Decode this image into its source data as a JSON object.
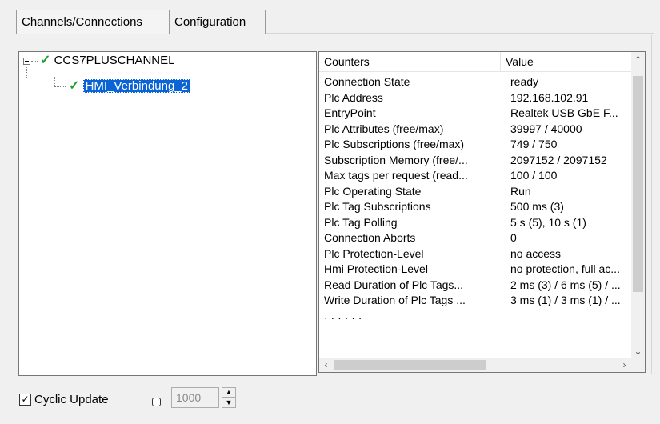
{
  "tabs": [
    {
      "label": "Channels/Connections",
      "active": true
    },
    {
      "label": "Configuration",
      "active": false
    }
  ],
  "tree": {
    "root": {
      "label": "CCS7PLUSCHANNEL",
      "icon": "check-icon",
      "expanded": true
    },
    "child": {
      "label": "HMI_Verbindung_2",
      "icon": "check-icon",
      "selected": true
    }
  },
  "counters": {
    "columns": [
      "Counters",
      "Value"
    ],
    "rows": [
      {
        "name": "Connection State",
        "value": "ready"
      },
      {
        "name": "Plc Address",
        "value": "192.168.102.91"
      },
      {
        "name": "EntryPoint",
        "value": "Realtek USB GbE F..."
      },
      {
        "name": "Plc Attributes (free/max)",
        "value": "39997 / 40000"
      },
      {
        "name": "Plc Subscriptions (free/max)",
        "value": "749 / 750"
      },
      {
        "name": "Subscription Memory (free/...",
        "value": "2097152 / 2097152"
      },
      {
        "name": "Max tags per request (read...",
        "value": "100 / 100"
      },
      {
        "name": "Plc Operating State",
        "value": "Run"
      },
      {
        "name": "Plc Tag Subscriptions",
        "value": "500 ms (3)"
      },
      {
        "name": "Plc Tag Polling",
        "value": "5 s (5), 10 s (1)"
      },
      {
        "name": "Connection Aborts",
        "value": "0"
      },
      {
        "name": "Plc Protection-Level",
        "value": "no access"
      },
      {
        "name": "Hmi Protection-Level",
        "value": "no protection, full ac..."
      },
      {
        "name": "Read Duration of Plc Tags...",
        "value": "2 ms (3) / 6 ms (5) / ..."
      },
      {
        "name": "Write Duration of Plc Tags ...",
        "value": "3 ms (1) / 3 ms (1) / ..."
      }
    ]
  },
  "footer": {
    "cyclic_update_label": "Cyclic Update",
    "cyclic_update_checked": true,
    "interval_value": "1000"
  },
  "colors": {
    "check": "#1f9f2e",
    "selection": "#0a64d6"
  }
}
